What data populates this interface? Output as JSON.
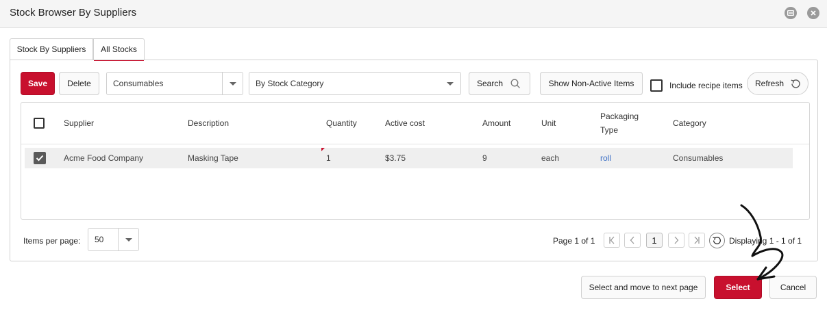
{
  "window": {
    "title": "Stock Browser By Suppliers"
  },
  "tabs": [
    {
      "label": "Stock By Suppliers",
      "active": false
    },
    {
      "label": "All Stocks",
      "active": true
    }
  ],
  "toolbar": {
    "save_label": "Save",
    "delete_label": "Delete",
    "supplier_dropdown_value": "Consumables",
    "category_dropdown_value": "By Stock Category",
    "search_label": "Search",
    "show_non_active_label": "Show Non-Active Items",
    "include_recipe_label": "Include recipe items",
    "include_recipe_checked": false,
    "refresh_label": "Refresh"
  },
  "table": {
    "columns": {
      "supplier": "Supplier",
      "description": "Description",
      "quantity": "Quantity",
      "active_cost": "Active cost",
      "amount": "Amount",
      "unit": "Unit",
      "packaging_type_line1": "Packaging",
      "packaging_type_line2": "Type",
      "category": "Category"
    },
    "rows": [
      {
        "checked": true,
        "supplier": "Acme Food Company",
        "description": "Masking Tape",
        "quantity": "1",
        "active_cost": "$3.75",
        "amount": "9",
        "unit": "each",
        "packaging_type": "roll",
        "category": "Consumables"
      }
    ]
  },
  "footer": {
    "items_per_page_label": "Items per page:",
    "items_per_page_value": "50",
    "page_info": "Page 1 of 1",
    "current_page": "1",
    "displaying": "Displaying 1 - 1 of 1"
  },
  "actions": {
    "select_next_label": "Select and move to next page",
    "select_label": "Select",
    "cancel_label": "Cancel"
  },
  "colors": {
    "accent": "#c8102e",
    "link": "#3b6fc6"
  },
  "icons": [
    "minimize-icon",
    "close-icon",
    "search-icon",
    "refresh-icon",
    "chevron-down-icon",
    "first-page-icon",
    "prev-page-icon",
    "next-page-icon",
    "last-page-icon",
    "checkmark-icon",
    "hand-drawn-arrow"
  ]
}
